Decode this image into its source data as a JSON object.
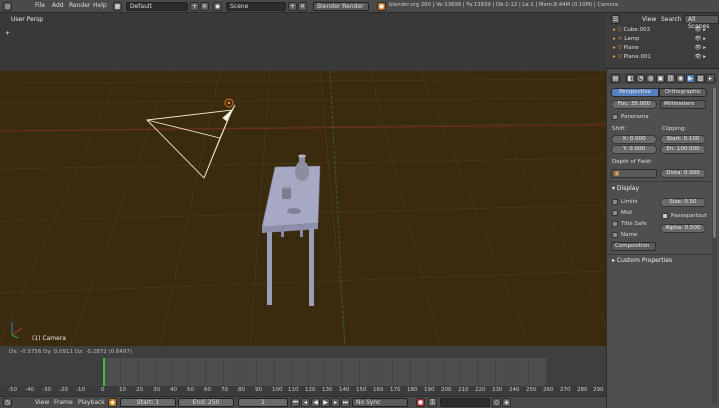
{
  "topbar": {
    "menus": [
      "File",
      "Add",
      "Render",
      "Help"
    ],
    "screen_layout": "Default",
    "scene": "Scene",
    "render_engine": "Blender Render",
    "info": "blender.org 260 | Ve:13698 | Fa:13939 | Ob:1-12 | La:1 | Mem:8.44M (0.10M) | Camera"
  },
  "viewport": {
    "view_name": "User Persp",
    "object_name": "(1) Camera",
    "status": "Dx: -0.5756  Dy: 0.0911  Dz: -0.2872 (0.6497)"
  },
  "outliner": {
    "header_view": "View",
    "header_search": "Search",
    "header_filter": "All Scenes",
    "items": [
      "Cube.003",
      "Lamp",
      "Plane",
      "Plane.001"
    ]
  },
  "properties": {
    "tab_perspective": "Perspective",
    "tab_orthographic": "Orthographic",
    "focal_length": "Foc: 35.000",
    "units": "Millimeters",
    "panorama_label": "Panorama",
    "shift_label": "Shift:",
    "shift_x": "X: 0.000",
    "shift_y": "Y: 0.000",
    "clipping_label": "Clipping:",
    "clip_start": "Start: 0.100",
    "clip_end": "En: 100.000",
    "dof_label": "Depth of Field:",
    "dof_distance": "Dista: 0.000",
    "display_header": "Display",
    "limits": "Limits",
    "mist": "Mist",
    "title_safe": "Title Safe",
    "name": "Name",
    "size": "Size: 0.50",
    "passepartout": "Passepartout",
    "alpha": "Alpha: 0.500",
    "composition": "Composition",
    "custom_props": "Custom Properties"
  },
  "timeline": {
    "ticks": [
      "-50",
      "-40",
      "-30",
      "-20",
      "-10",
      "0",
      "10",
      "20",
      "30",
      "40",
      "50",
      "60",
      "70",
      "80",
      "90",
      "100",
      "110",
      "120",
      "130",
      "140",
      "150",
      "160",
      "170",
      "180",
      "190",
      "200",
      "210",
      "220",
      "230",
      "240",
      "250",
      "260",
      "270",
      "280",
      "290"
    ],
    "current_frame": 1
  },
  "timeline_footer": {
    "menus": [
      "View",
      "Frame",
      "Playback"
    ],
    "start": "Start: 1",
    "end": "End: 250",
    "frame": "1",
    "sync": "No Sync"
  }
}
